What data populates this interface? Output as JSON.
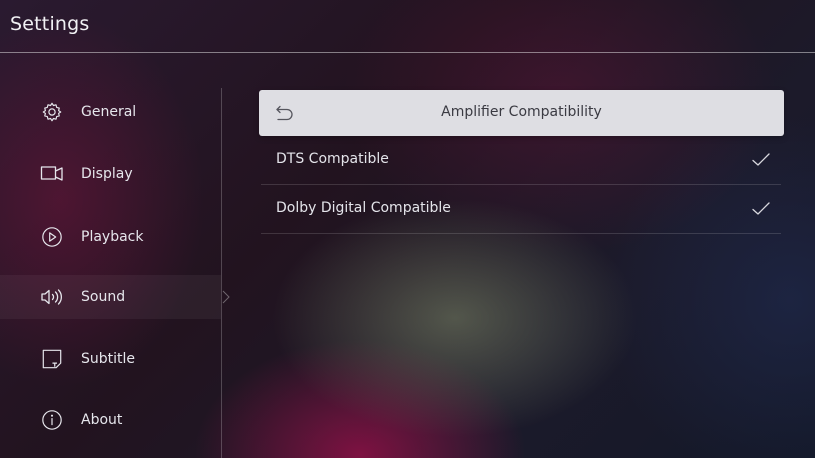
{
  "header": {
    "title": "Settings"
  },
  "sidebar": {
    "items": [
      {
        "label": "General",
        "icon": "gear-icon"
      },
      {
        "label": "Display",
        "icon": "display-icon"
      },
      {
        "label": "Playback",
        "icon": "play-circle-icon"
      },
      {
        "label": "Sound",
        "icon": "speaker-icon",
        "selected": true
      },
      {
        "label": "Subtitle",
        "icon": "subtitle-icon"
      },
      {
        "label": "About",
        "icon": "info-icon"
      }
    ]
  },
  "panel": {
    "title": "Amplifier Compatibility",
    "back_icon": "back-arrow-icon",
    "options": [
      {
        "label": "DTS Compatible",
        "checked": true
      },
      {
        "label": "Dolby Digital Compatible",
        "checked": true
      }
    ]
  },
  "colors": {
    "header_divider": "#ffffff",
    "panel_header_bg": "#dedee3",
    "panel_header_text": "#3a3a42",
    "text": "#e6e6ec"
  }
}
